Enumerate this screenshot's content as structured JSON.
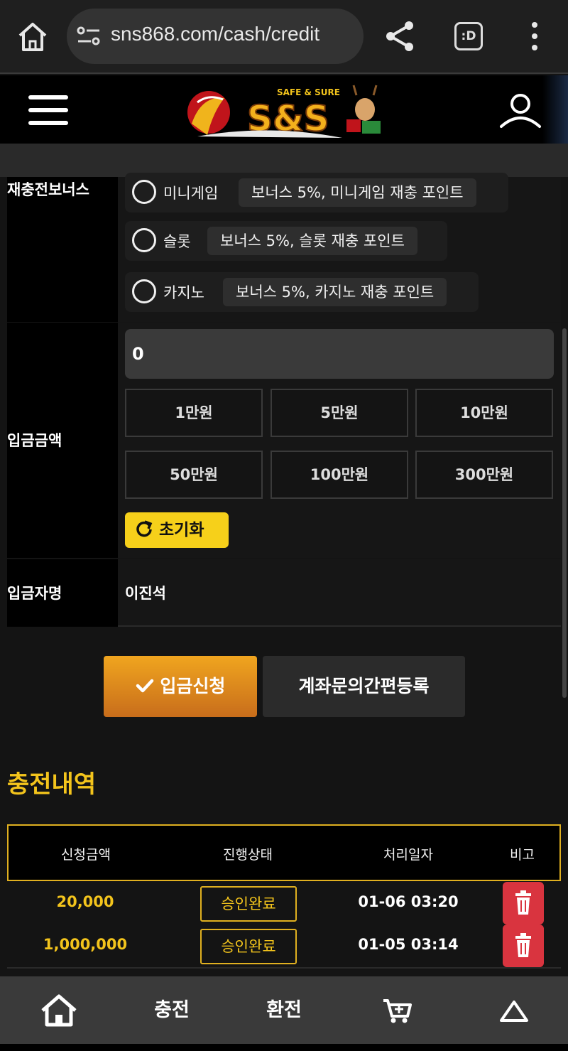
{
  "browser": {
    "url": "sns868.com/cash/credit",
    "tab_label": ":D"
  },
  "header": {
    "logo_tagline": "SAFE & SURE",
    "logo_text": "S&S"
  },
  "form": {
    "bonus_label": "재충전보너스",
    "bonus_options": [
      {
        "name": "미니게임",
        "tag": "보너스 5%, 미니게임 재충 포인트"
      },
      {
        "name": "슬롯",
        "tag": "보너스 5%, 슬롯 재충 포인트"
      },
      {
        "name": "카지노",
        "tag": "보너스 5%, 카지노 재충 포인트"
      }
    ],
    "amount_label": "입금금액",
    "amount_value": "0",
    "amount_buttons": [
      "1만원",
      "5만원",
      "10만원",
      "50만원",
      "100만원",
      "300만원"
    ],
    "reset_label": "초기화",
    "depositor_label": "입금자명",
    "depositor_value": "이진석"
  },
  "actions": {
    "deposit_label": "입금신청",
    "register_label": "계좌문의간편등록"
  },
  "history": {
    "title": "충전내역",
    "columns": [
      "신청금액",
      "진행상태",
      "처리일자",
      "비고"
    ],
    "rows": [
      {
        "amount": "20,000",
        "status": "승인완료",
        "date": "01-06 03:20"
      },
      {
        "amount": "1,000,000",
        "status": "승인완료",
        "date": "01-05 03:14"
      }
    ]
  },
  "bottom_nav": {
    "charge": "충전",
    "exchange": "환전"
  },
  "colors": {
    "accent_yellow": "#f3c41c",
    "delete_red": "#d9343f",
    "deposit_orange": "#e39420"
  }
}
